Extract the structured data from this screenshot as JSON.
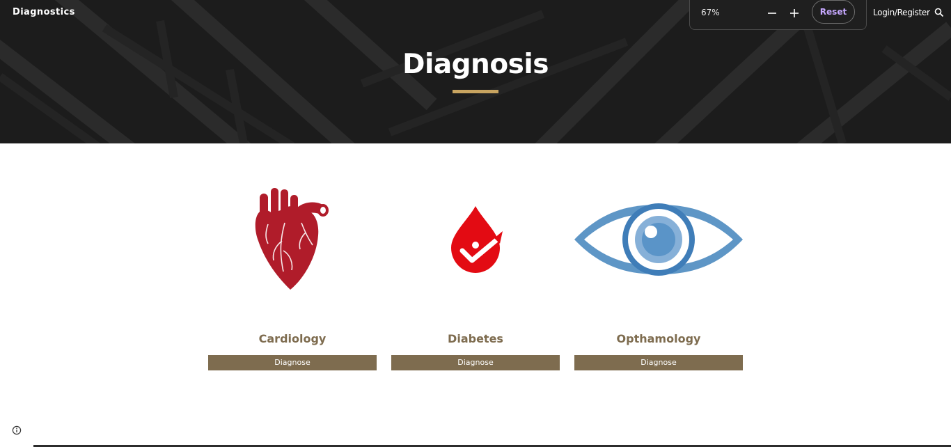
{
  "header": {
    "brand": "Diagnostics",
    "login_label": "Login/Register",
    "title": "Diagnosis"
  },
  "zoom": {
    "level": "67%",
    "reset_label": "Reset"
  },
  "cards": [
    {
      "title": "Cardiology",
      "button_label": "Diagnose",
      "icon": "heart-icon",
      "color": "#b01c2a"
    },
    {
      "title": "Diabetes",
      "button_label": "Diagnose",
      "icon": "blood-drop-icon",
      "color": "#e30b13"
    },
    {
      "title": "Opthamology",
      "button_label": "Diagnose",
      "icon": "eye-icon",
      "color": "#4a86be"
    }
  ],
  "colors": {
    "accent": "#c8a460",
    "button": "#7e6c4f",
    "reset_text": "#c6a8ff"
  }
}
